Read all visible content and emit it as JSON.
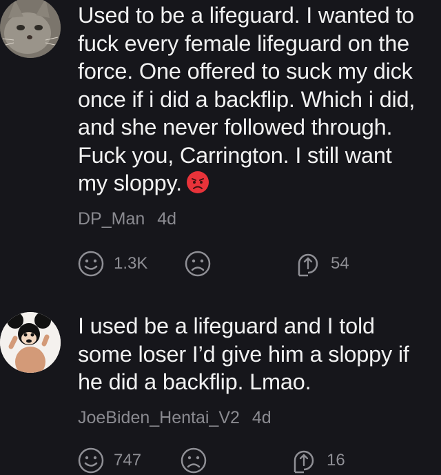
{
  "comments": [
    {
      "text": "Used to be a lifeguard. I wanted to\nfuck every female lifeguard on the\nforce. One offered to suck my dick\nonce if i did a backflip. Which i did,\nand she never followed through.\nFuck you, Carrington. I still want\nmy sloppy.",
      "emoji": "angry-face-emoji",
      "author": "DP_Man",
      "age": "4d",
      "likes": "1.3K",
      "replies": "54",
      "avatar": "cat-avatar"
    },
    {
      "text": "I used be a lifeguard and I told\nsome loser I’d give him a sloppy if\nhe did a backflip. Lmao.",
      "author": "JoeBiden_Hentai_V2",
      "age": "4d",
      "likes": "747",
      "replies": "16",
      "avatar": "mouse-mask-avatar"
    }
  ],
  "colors": {
    "background": "#16161b",
    "text": "#f1f1f1",
    "meta": "#8a8a90"
  }
}
